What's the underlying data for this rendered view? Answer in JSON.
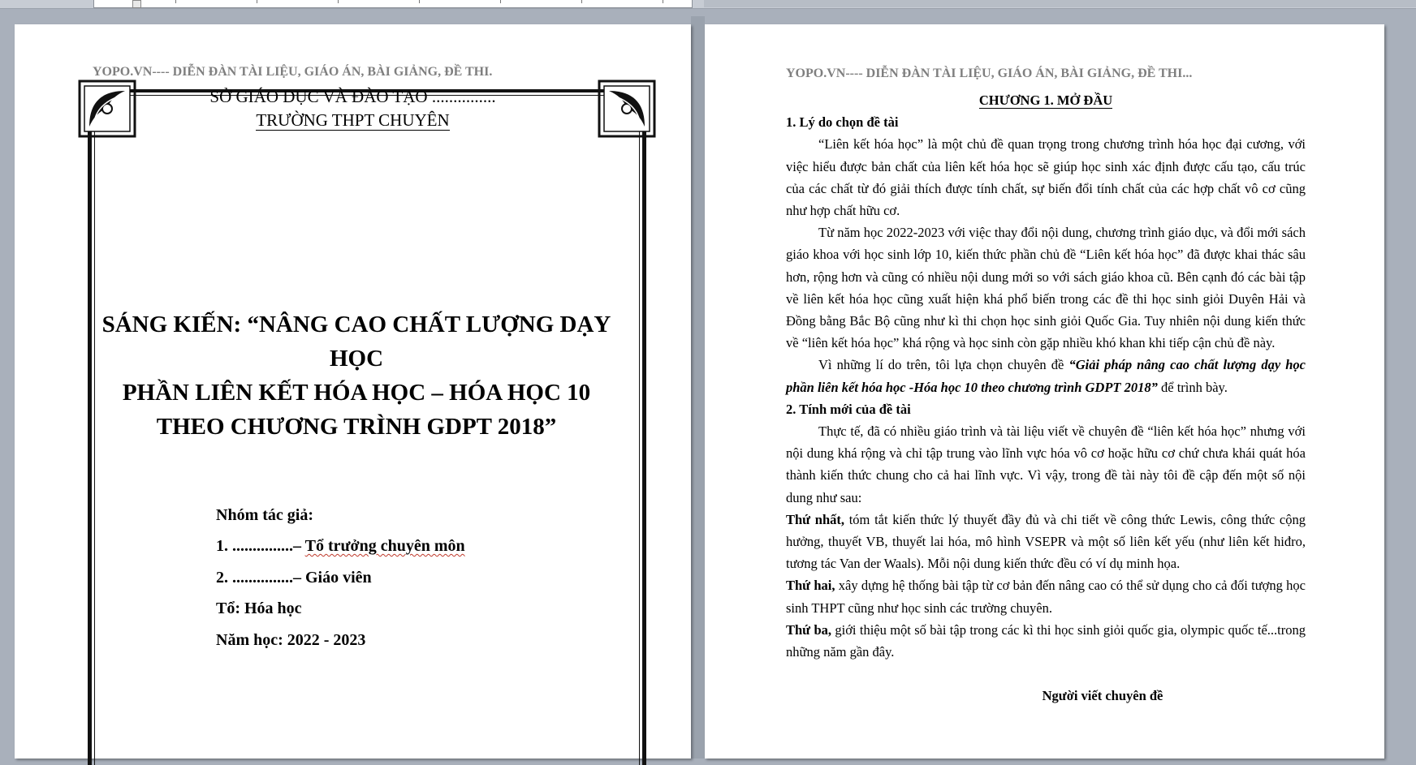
{
  "page1": {
    "header": "YOPO.VN---- DIỄN ĐÀN TÀI LIỆU, GIÁO ÁN, BÀI GIẢNG, ĐỀ THI.",
    "department": "SỞ GIÁO DỤC VÀ ĐÀO TẠO ...............",
    "school": "TRƯỜNG THPT CHUYÊN",
    "title_lines": [
      "SÁNG KIẾN: “NÂNG CAO CHẤT LƯỢNG DẠY HỌC",
      "PHẦN LIÊN KẾT HÓA HỌC – HÓA HỌC 10",
      "THEO CHƯƠNG TRÌNH GDPT 2018”"
    ],
    "authors_label": "Nhóm tác giả:",
    "author1_prefix": "1. ...............–",
    "author1_role": "Tổ trưởng chuyên môn",
    "author2": "2. ...............– Giáo viên",
    "group": "Tổ: Hóa học",
    "school_year": "Năm học: 2022 - 2023"
  },
  "page2": {
    "header": "YOPO.VN---- DIỄN ĐÀN TÀI LIỆU, GIÁO ÁN, BÀI GIẢNG, ĐỀ THI...",
    "chapter": "CHƯƠNG 1. MỞ ĐẦU",
    "s1_heading": "1. Lý do chọn đề tài",
    "s1_p1": "“Liên kết hóa học” là một chủ đề quan trọng trong chương trình hóa học đại cương, với việc hiểu được bản chất của liên kết hóa học sẽ giúp học sinh xác định được cấu tạo, cấu trúc của các chất từ đó giải thích được tính chất, sự biến đổi tính chất của các hợp chất vô cơ cũng như hợp chất hữu cơ.",
    "s1_p2": "Từ năm học 2022-2023 với việc thay đổi nội dung, chương trình giáo dục, và đổi mới sách giáo khoa với học sinh lớp 10, kiến thức phần chủ đề “Liên kết hóa học” đã được khai thác sâu hơn, rộng hơn và cũng có nhiều nội dung mới so với sách giáo khoa cũ. Bên cạnh đó các bài tập về liên kết hóa học cũng xuất hiện khá phổ biến trong các đề thi học sinh giỏi Duyên Hải và Đồng bằng Bắc Bộ cũng như kì thi chọn học sinh giỏi Quốc Gia. Tuy nhiên nội dung kiến thức về “liên kết hóa học” khá rộng và học sinh còn gặp nhiều khó khan khi tiếp cận chủ đề này.",
    "s1_p3_pre": "Vì những lí do trên, tôi lựa chọn chuyên đề ",
    "s1_p3_bold": "“Giải pháp nâng cao chất lượng dạy học phần liên kết hóa học -Hóa học 10 theo chương trình GDPT 2018”",
    "s1_p3_post": " để trình bày.",
    "s2_heading": "2. Tính mới của đề tài",
    "s2_p1": "Thực tế, đã có nhiều giáo trình và tài liệu viết về chuyên đề “liên kết hóa học” nhưng với nội dung khá rộng và chỉ tập trung vào lĩnh vực hóa vô cơ hoặc hữu cơ chứ chưa khái quát hóa thành kiến thức chung cho cả hai lĩnh vực. Vì vậy, trong đề tài này tôi đề cập đến một số nội dung như sau:",
    "first_label": "Thứ nhất,",
    "first_text": " tóm tắt kiến thức lý thuyết đầy đủ và chi tiết về công thức Lewis, công thức cộng hưởng, thuyết VB, thuyết lai hóa, mô hình VSEPR và một số liên kết yếu (như liên kết hiđro, tương tác Van der Waals). Mỗi nội dung kiến thức đều có ví dụ minh họa.",
    "second_label": "Thứ hai,",
    "second_text": " xây dựng hệ thống bài tập từ cơ bản đến nâng cao có thể sử dụng cho cả đối tượng học sinh THPT cũng như học sinh các trường chuyên.",
    "third_label": "Thứ ba,",
    "third_text": " giới thiệu một số bài tập trong các kì thi học sinh giỏi quốc gia, olympic quốc tế...trong những năm gần đây.",
    "signer": "Người viết chuyên đề"
  }
}
